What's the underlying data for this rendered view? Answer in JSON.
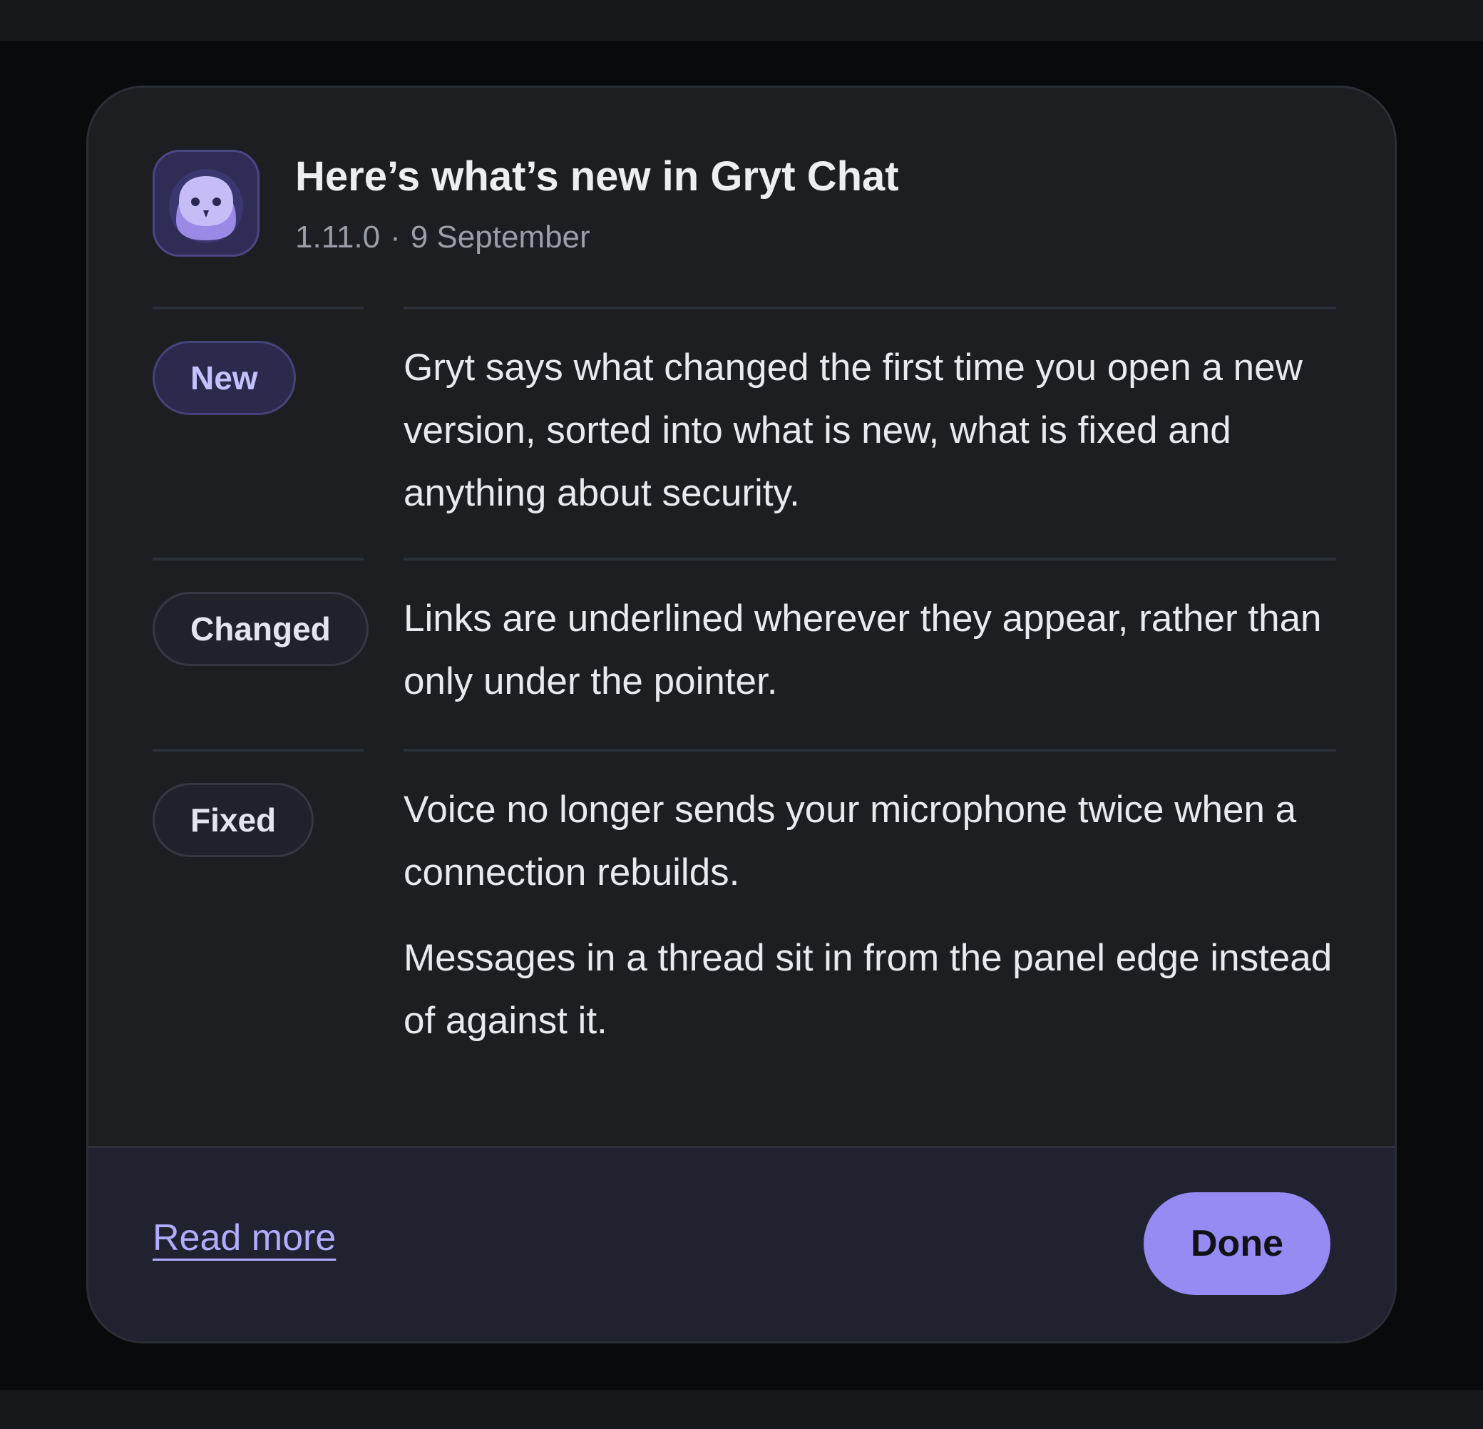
{
  "dialog": {
    "app_icon": "owl-icon",
    "title": "Here’s what’s new in Gryt Chat",
    "version": "1.11.0",
    "separator": "·",
    "date": "9 September"
  },
  "entries": [
    {
      "tag": "New",
      "items": [
        "Gryt says what changed the first time you open a new version, sorted into what is new, what is fixed and anything about security."
      ]
    },
    {
      "tag": "Changed",
      "items": [
        "Links are underlined wherever they appear, rather than only under the pointer."
      ]
    },
    {
      "tag": "Fixed",
      "items": [
        "Voice no longer sends your microphone twice when a connection rebuilds.",
        "Messages in a thread sit in from the panel edge instead of against it."
      ]
    }
  ],
  "footer": {
    "read_more_label": "Read more",
    "done_label": "Done"
  },
  "colors": {
    "accent": "#958bf2",
    "accent_text": "#b0acff",
    "dialog_bg": "#1c1e22",
    "footer_bg": "#212230",
    "page_bg": "#090a0c"
  }
}
